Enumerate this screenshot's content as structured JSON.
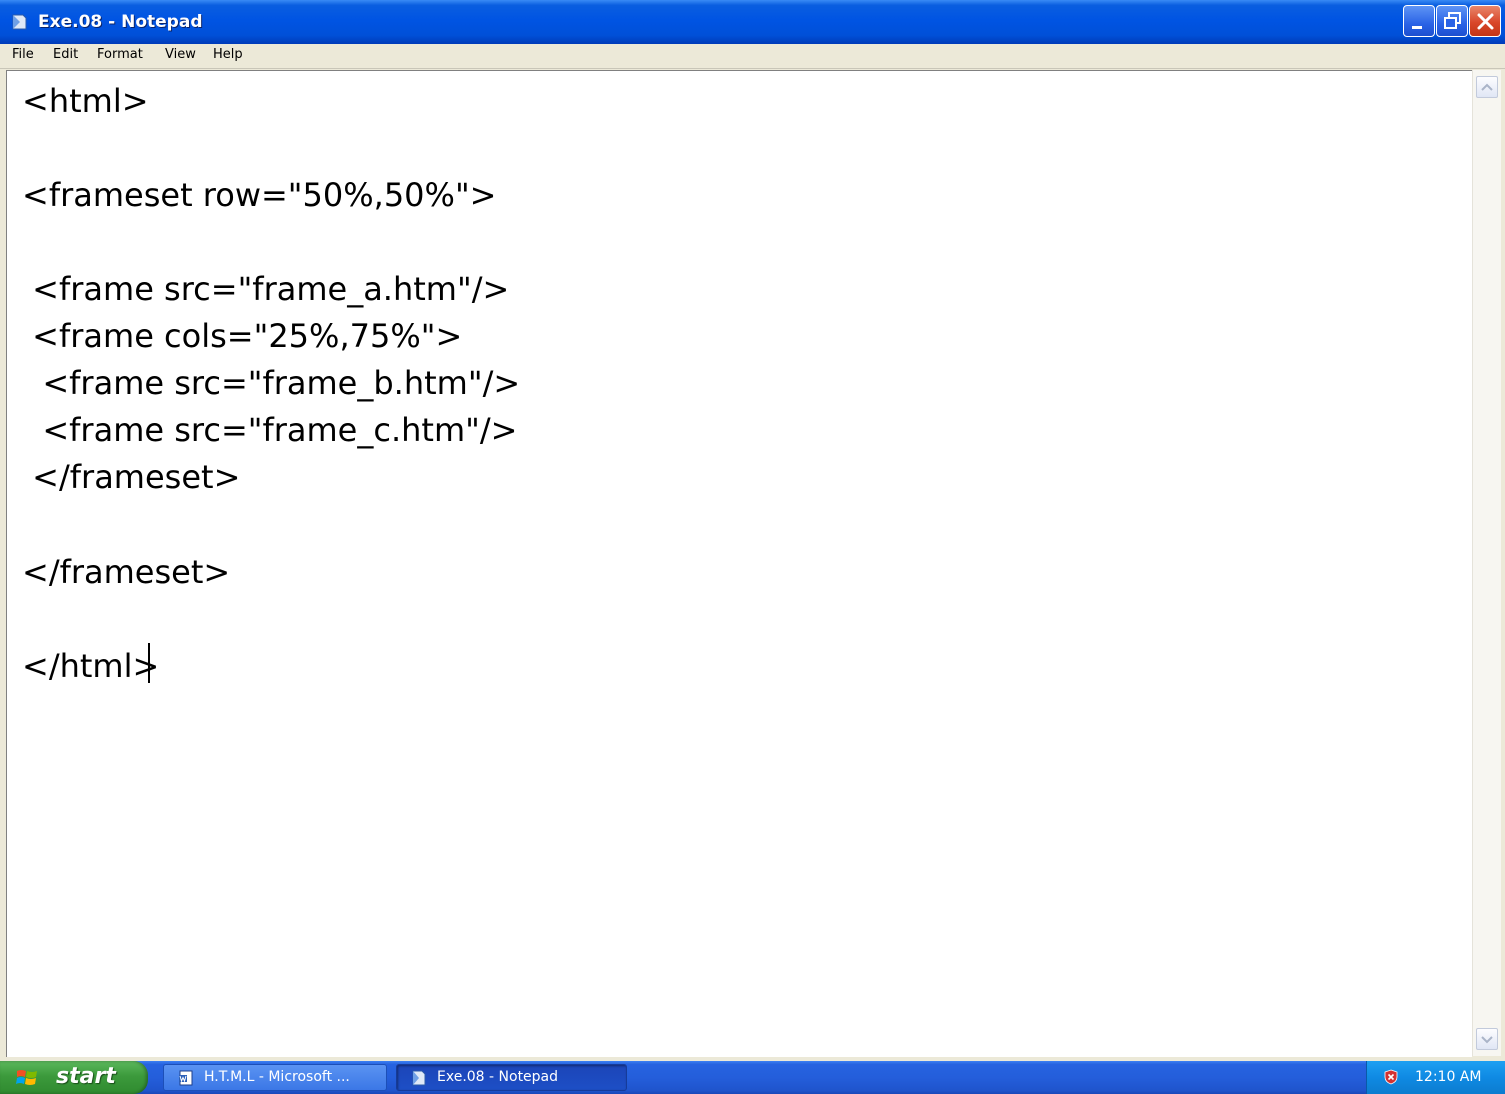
{
  "window": {
    "title": "Exe.08 - Notepad",
    "icon": "notepad-icon",
    "controls": [
      "minimize-icon",
      "restore-icon",
      "close-icon"
    ]
  },
  "menu": {
    "items": [
      "File",
      "Edit",
      "Format",
      "View",
      "Help"
    ]
  },
  "editor": {
    "lines": [
      "<html>",
      "",
      "<frameset row=\"50%,50%\">",
      "",
      " <frame src=\"frame_a.htm\"/>",
      " <frame cols=\"25%,75%\">",
      "  <frame src=\"frame_b.htm\"/>",
      "  <frame src=\"frame_c.htm\"/>",
      " </frameset>",
      "",
      "</frameset>",
      "",
      "</html>"
    ]
  },
  "taskbar": {
    "start_label": "start",
    "tasks": [
      {
        "label": "H.T.M.L - Microsoft ...",
        "icon": "word-doc-icon",
        "active": false
      },
      {
        "label": "Exe.08 - Notepad",
        "icon": "notepad-icon",
        "active": true
      }
    ],
    "tray_icon": "security-shield-icon",
    "clock": "12:10 AM"
  },
  "colors": {
    "titlebar": "#0054e3",
    "taskbar": "#245edb",
    "start": "#3c9a3c",
    "tray": "#0f8ae3",
    "close_button": "#d9472a"
  }
}
